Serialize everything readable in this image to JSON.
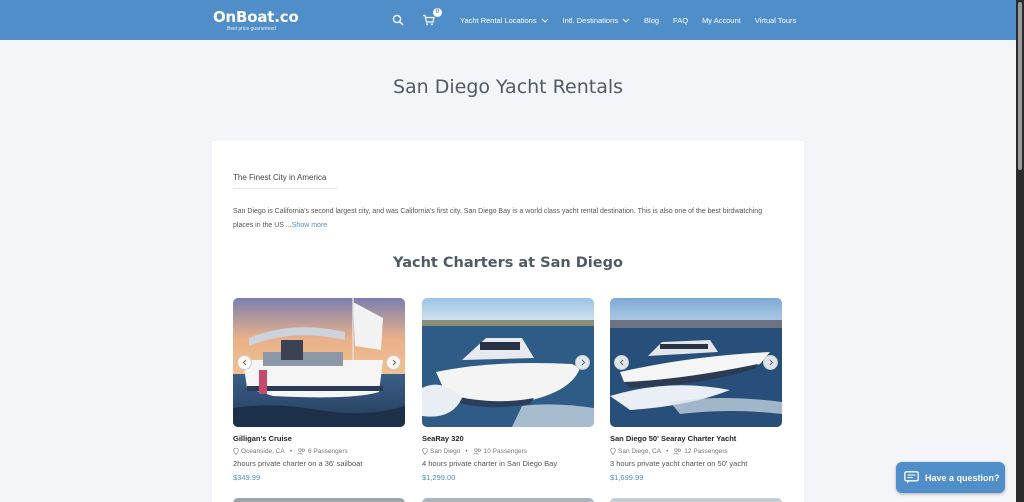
{
  "header": {
    "logo": "OnBoat.co",
    "tagline": "Best price guaranteed",
    "cart_count": "0",
    "nav": [
      "Yacht Rental Locations",
      "Intl. Destinations",
      "Blog",
      "FAQ",
      "My Account",
      "Virtual Tours"
    ]
  },
  "page_title": "San Diego Yacht Rentals",
  "intro": {
    "heading": "The Finest City in America",
    "text": "San Diego is California's second largest city, and was California's first city. San Diego Bay is a world class yacht rental destination. This is also one of the best birdwatching places in the US ...",
    "show_more": "Show more"
  },
  "section_title": "Yacht Charters at San Diego",
  "listings": [
    {
      "name": "Gilligan's Cruise",
      "location": "Oceanside, CA",
      "passengers": "6 Passengers",
      "description": "2hours private charter on a 36' sailboat",
      "price": "$349.99"
    },
    {
      "name": "SeaRay 320",
      "location": "San Diego",
      "passengers": "10 Passengers",
      "description": "4 hours private charter in San Diego Bay",
      "price": "$1,299.00"
    },
    {
      "name": "San Diego 50' Searay Charter Yacht",
      "location": "San Diego, CA",
      "passengers": "12 Passengers",
      "description": "3 hours private yacht charter on 50' yacht",
      "price": "$1,699.99"
    }
  ],
  "chat": {
    "label": "Have a question?"
  },
  "colors": {
    "brand": "#4f8ec9",
    "background": "#f4f5f8"
  }
}
